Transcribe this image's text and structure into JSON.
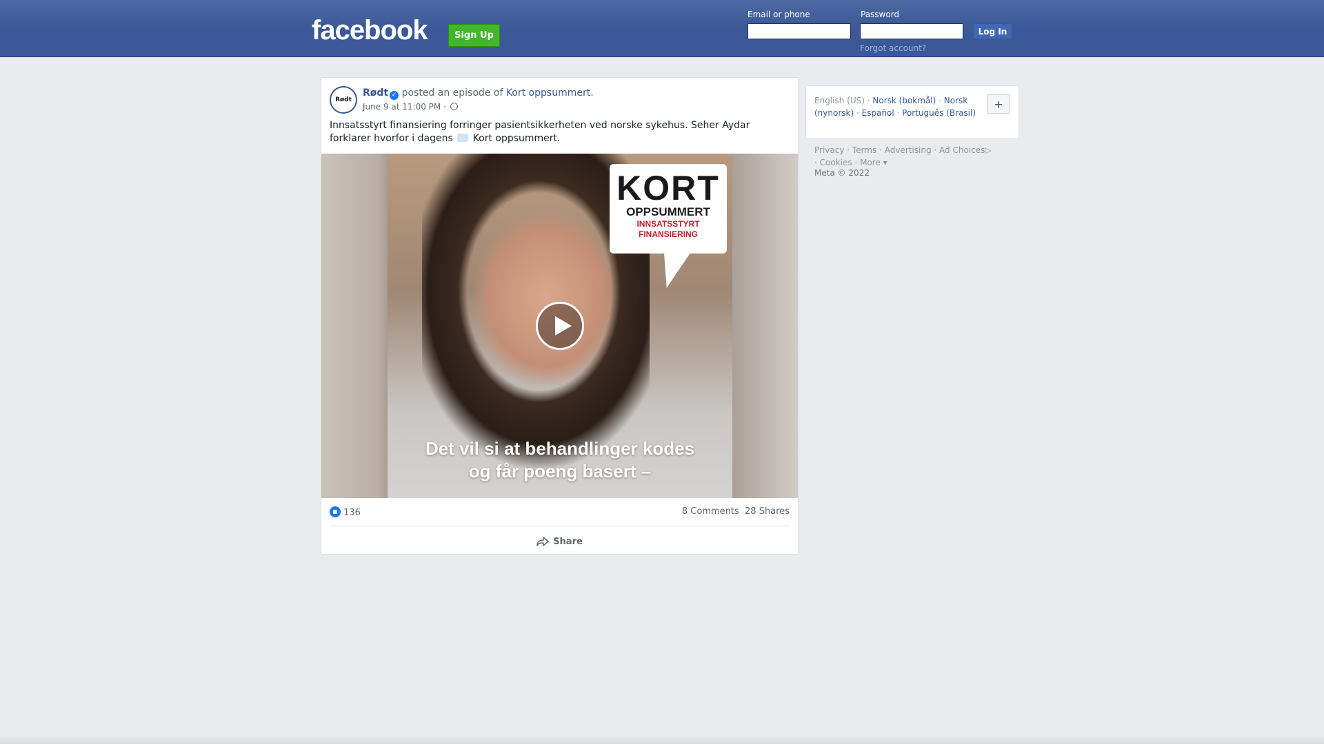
{
  "header": {
    "logo": "facebook",
    "signup_label": "Sign Up",
    "email_label": "Email or phone",
    "password_label": "Password",
    "email_value": "",
    "password_value": "",
    "login_label": "Log In",
    "forgot_label": "Forgot account?"
  },
  "post": {
    "avatar_text": "Rødt",
    "page_name": "Rødt",
    "verified": true,
    "action_text": " posted an episode of ",
    "episode_link": "Kort oppsummert.",
    "timestamp": "June 9 at 11:00 PM",
    "meta_separator": "·",
    "message_part1": "Innsatsstyrt finansiering forringer pasientsikkerheten ved norske sykehus. Seher Aydar forklarer hvorfor i dagens",
    "message_part2": "Kort oppsummert.",
    "video": {
      "bubble_line1": "KORT",
      "bubble_line2": "OPPSUMMERT",
      "bubble_line3": "INNSATSSTYRT",
      "bubble_line4": "FINANSIERING",
      "subtitle_line1": "Det vil si at behandlinger kodes",
      "subtitle_line2": "og får poeng basert –"
    },
    "likes": "136",
    "comments": "8 Comments",
    "shares": "28 Shares",
    "share_label": "Share"
  },
  "sidebar": {
    "current_language": "English (US)",
    "languages": [
      "Norsk (bokmål)",
      "Norsk (nynorsk)",
      "Español",
      "Português (Brasil)"
    ],
    "footer_links": [
      "Privacy",
      "Terms",
      "Advertising",
      "Ad Choices",
      "Cookies",
      "More"
    ],
    "copyright": "Meta © 2022"
  },
  "colors": {
    "header_blue": "#3b5998",
    "signup_green": "#42b72a",
    "link_blue": "#385898",
    "like_blue": "#1877f2"
  }
}
